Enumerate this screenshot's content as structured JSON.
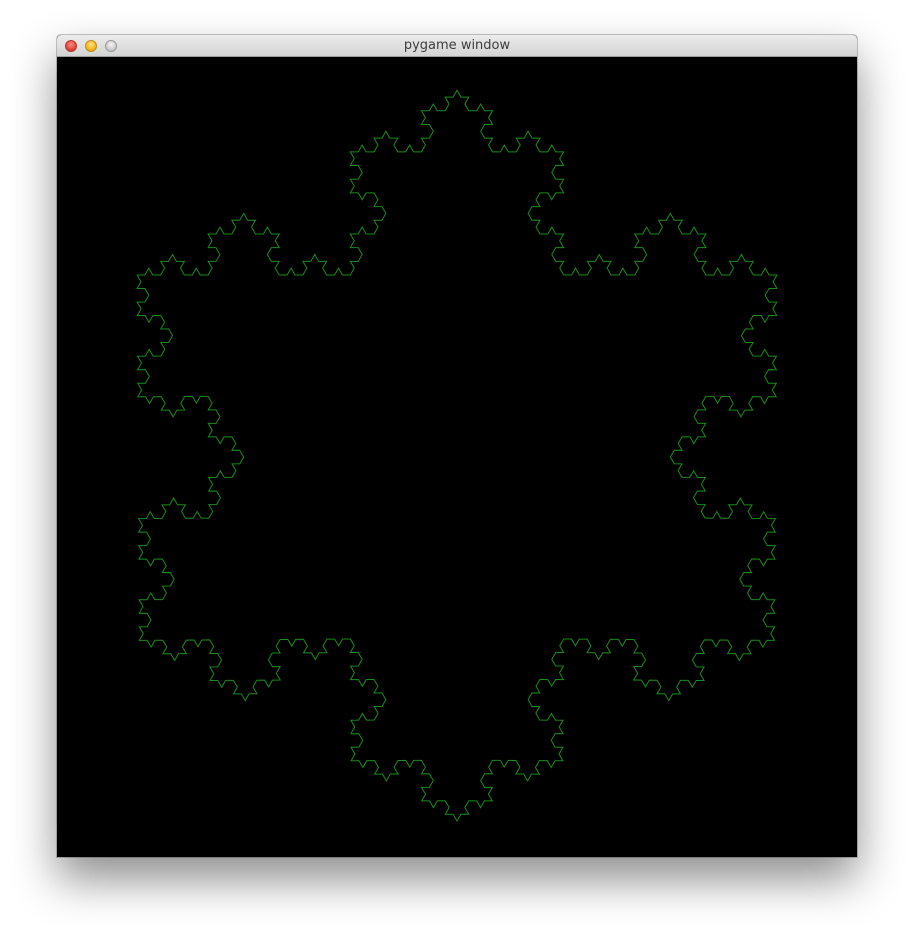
{
  "window": {
    "title": "pygame window",
    "controls": {
      "close": "close-icon",
      "minimize": "minimize-icon",
      "zoom": "zoom-icon"
    }
  },
  "canvas": {
    "background_color": "#000000",
    "fractal": {
      "shape": "koch-snowflake",
      "stroke_color": "#1a8c1a",
      "iterations": 4
    }
  }
}
